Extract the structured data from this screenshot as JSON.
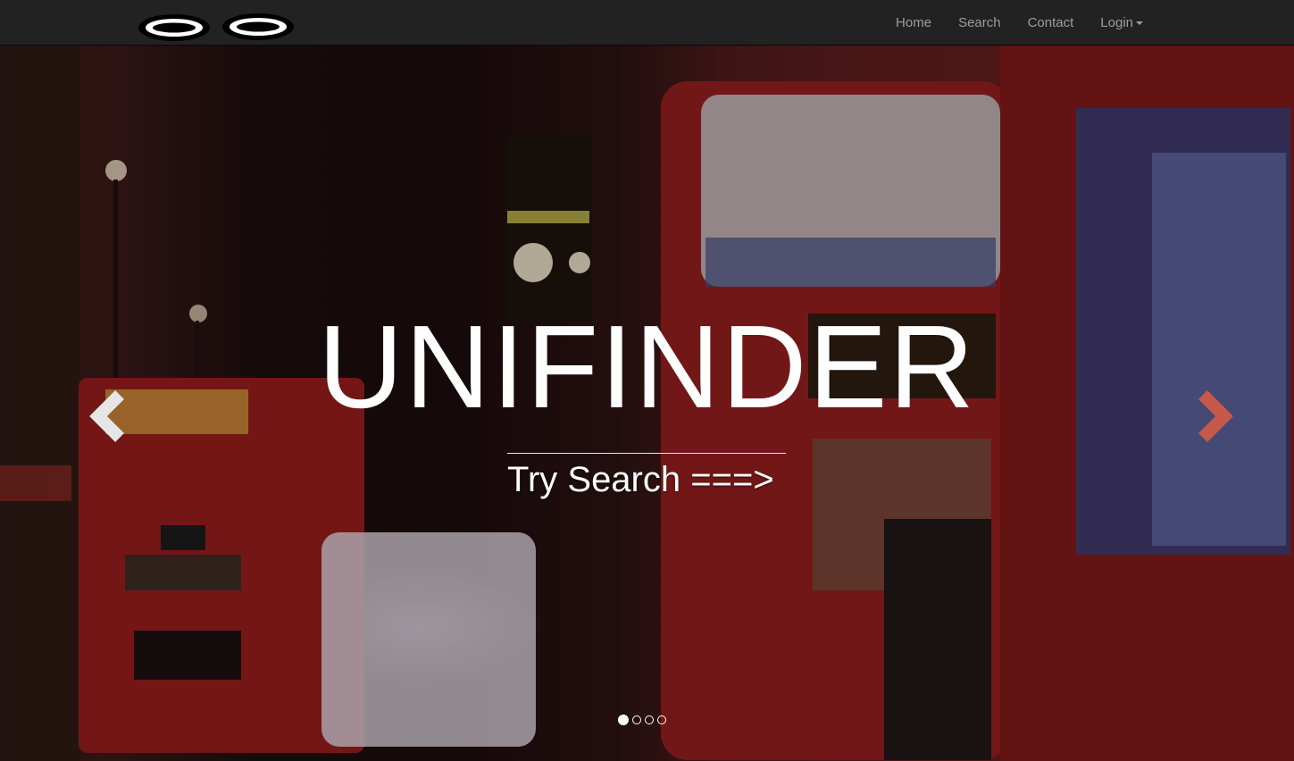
{
  "navbar": {
    "brand_logo": "brand-logo",
    "links": [
      {
        "label": "Home"
      },
      {
        "label": "Search"
      },
      {
        "label": "Contact"
      },
      {
        "label": "Login"
      }
    ]
  },
  "hero": {
    "title": "UNIFINDER",
    "cta": "Try Search ===>",
    "prev_icon": "chevron-left-icon",
    "next_icon": "chevron-right-icon",
    "slide_count": 4,
    "active_slide": 1
  },
  "colors": {
    "navbar_bg": "#222222",
    "nav_text": "#9d9d9d",
    "hero_text": "#ffffff",
    "next_arrow": "#c8594a"
  }
}
